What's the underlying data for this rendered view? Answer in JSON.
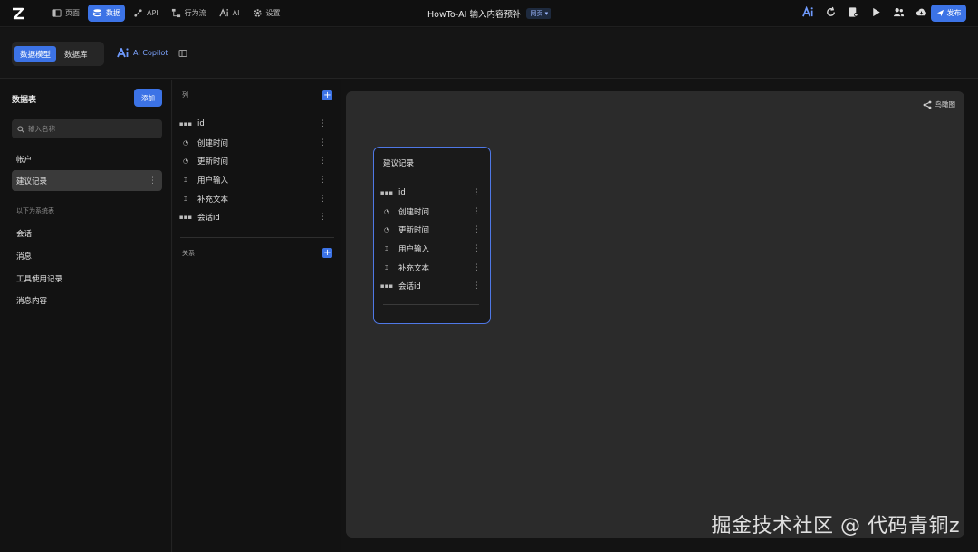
{
  "topbar": {
    "nav": [
      {
        "label": "页面",
        "icon": "page-icon"
      },
      {
        "label": "数据",
        "icon": "database-icon",
        "active": true
      },
      {
        "label": "API",
        "icon": "api-icon"
      },
      {
        "label": "行为流",
        "icon": "flow-icon"
      },
      {
        "label": "AI",
        "icon": "ai-icon"
      },
      {
        "label": "设置",
        "icon": "gear-icon"
      }
    ],
    "app_title": "HowTo-AI 输入内容预补",
    "badge": "网页 ▾",
    "publish_label": "发布"
  },
  "subbar": {
    "tabs": [
      {
        "label": "数据模型",
        "active": true
      },
      {
        "label": "数据库",
        "active": false
      }
    ],
    "copilot_label": "AI Copilot"
  },
  "sidebar": {
    "title": "数据表",
    "add_label": "添加",
    "search_placeholder": "输入名称",
    "user_tables": [
      "帐户",
      "建议记录"
    ],
    "active_table": "建议记录",
    "system_label": "以下为系统表",
    "system_tables": [
      "会话",
      "消息",
      "工具使用记录",
      "消息内容"
    ]
  },
  "columns_panel": {
    "columns_header": "列",
    "relations_header": "关系",
    "columns": [
      {
        "name": "id",
        "icon": "id-icon"
      },
      {
        "name": "创建时间",
        "icon": "time-icon"
      },
      {
        "name": "更新时间",
        "icon": "time-icon"
      },
      {
        "name": "用户输入",
        "icon": "text-icon"
      },
      {
        "name": "补充文本",
        "icon": "text-icon"
      },
      {
        "name": "会话id",
        "icon": "id-icon"
      }
    ]
  },
  "canvas": {
    "birdview_label": "鸟瞰图",
    "card_title": "建议记录"
  },
  "watermark": "掘金技术社区 @ 代码青铜z",
  "colors": {
    "accent": "#3c73e6",
    "card_border": "#4f78e6"
  }
}
